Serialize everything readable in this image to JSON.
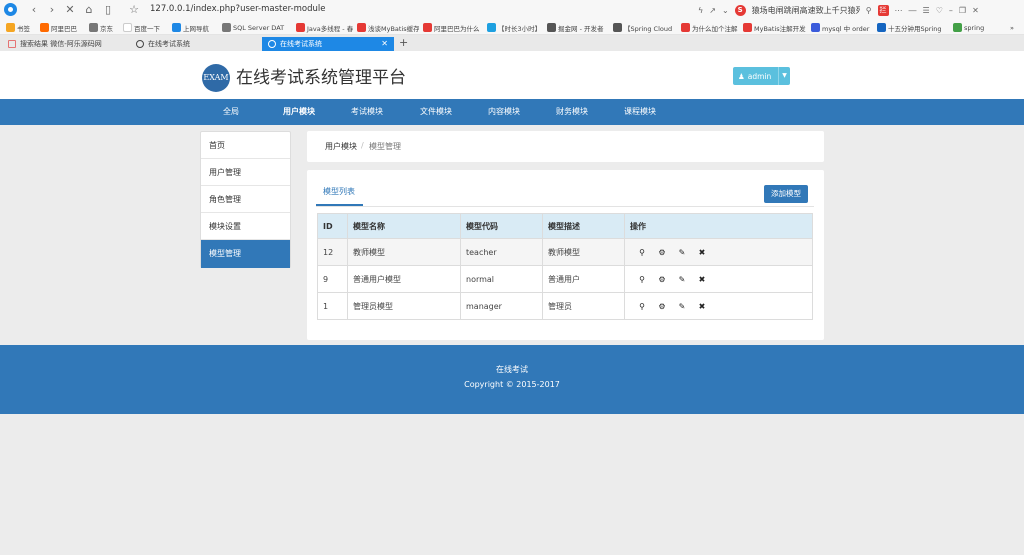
{
  "browser": {
    "address_url": "127.0.0.1/index.php?user-master-module",
    "search_text": "猿场电闸跳闸高速致上千只猿死亡",
    "bookmarks": [
      {
        "label": "书签",
        "color": "#f5a623"
      },
      {
        "label": "阿里巴巴",
        "color": "#ff6a00"
      },
      {
        "label": "京东",
        "color": "#777777"
      },
      {
        "label": "百度一下",
        "color": "#ffffff"
      },
      {
        "label": "上网导航",
        "color": "#1e88e5"
      },
      {
        "label": "SQL Server DAT",
        "color": "#777777"
      },
      {
        "label": "Java多线程 - 春",
        "color": "#e53935"
      },
      {
        "label": "浅谈MyBatis缓存",
        "color": "#e53935"
      },
      {
        "label": "阿里巴巴为什么",
        "color": "#e53935"
      },
      {
        "label": "【时长3小时】",
        "color": "#1ea0e0"
      },
      {
        "label": "掘金网 - 开发者",
        "color": "#555555"
      },
      {
        "label": "【Spring Cloud",
        "color": "#555555"
      },
      {
        "label": "为什么加个注解",
        "color": "#e53935"
      },
      {
        "label": "MyBatis注解开发",
        "color": "#e53935"
      },
      {
        "label": "mysql 中 order",
        "color": "#3b5bdb"
      },
      {
        "label": "十五分钟用Spring",
        "color": "#1565c0"
      },
      {
        "label": "spring",
        "color": "#43a047"
      }
    ],
    "tabs": [
      {
        "label": "搜索结果 微信-阿乐源码网",
        "active": false
      },
      {
        "label": "在线考试系统",
        "active": false
      },
      {
        "label": "在线考试系统",
        "active": true
      }
    ],
    "new_tab": "+",
    "tab_close": "✕"
  },
  "header": {
    "logo_text": "EXAM",
    "title": "在线考试系统管理平台",
    "user_label": "admin",
    "user_icon": "user-icon",
    "caret": "▼"
  },
  "nav": {
    "items": [
      {
        "label": "全局",
        "active": false
      },
      {
        "label": "用户模块",
        "active": true
      },
      {
        "label": "考试模块",
        "active": false
      },
      {
        "label": "文件模块",
        "active": false
      },
      {
        "label": "内容模块",
        "active": false
      },
      {
        "label": "财务模块",
        "active": false
      },
      {
        "label": "课程模块",
        "active": false
      }
    ]
  },
  "sidebar": {
    "items": [
      {
        "label": "首页",
        "active": false
      },
      {
        "label": "用户管理",
        "active": false
      },
      {
        "label": "角色管理",
        "active": false
      },
      {
        "label": "模块设置",
        "active": false
      },
      {
        "label": "模型管理",
        "active": true
      }
    ]
  },
  "breadcrumb": {
    "parent": "用户模块",
    "separator": "/",
    "current": "模型管理"
  },
  "panel": {
    "tab_label": "模型列表",
    "add_button": "添加模型"
  },
  "table": {
    "headers": [
      "ID",
      "模型名称",
      "模型代码",
      "模型描述",
      "操作"
    ],
    "rows": [
      {
        "id": "12",
        "name": "教师模型",
        "code": "teacher",
        "desc": "教师模型"
      },
      {
        "id": "9",
        "name": "普通用户模型",
        "code": "normal",
        "desc": "普通用户"
      },
      {
        "id": "1",
        "name": "管理员模型",
        "code": "manager",
        "desc": "管理员"
      }
    ],
    "action_icons": [
      "search-icon",
      "gear-icon",
      "edit-icon",
      "close-icon"
    ]
  },
  "footer": {
    "title": "在线考试",
    "copyright": "Copyright © 2015-2017"
  },
  "colors": {
    "primary": "#3178b8",
    "info": "#5bc0de",
    "table_head": "#d9ebf5",
    "page_bg": "#ececec"
  }
}
